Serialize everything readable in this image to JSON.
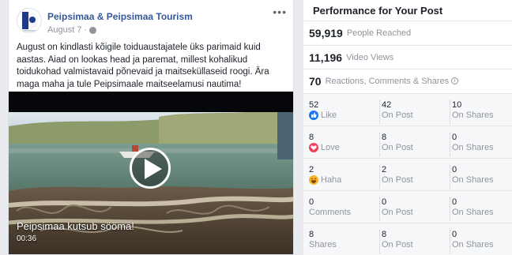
{
  "post": {
    "page_name": "Peipsimaa & Peipsimaa Tourism",
    "date": "August 7",
    "dot": "·",
    "more": "•••",
    "text": "August on kindlasti kõigile toiduaustajatele üks parimaid kuid aastas. Aiad on lookas head ja paremat, millest kohalikud toidukohad valmistavaid põnevaid ja maitseküllaseid roogi. Ära maga maha ja tule Peipsimaale maitseelamusi nautima!",
    "video": {
      "caption": "Peipsimaa kutsub sööma!",
      "time": "00:36"
    }
  },
  "performance": {
    "title": "Performance for Your Post",
    "people_reached": {
      "value": "59,919",
      "label": "People Reached"
    },
    "video_views": {
      "value": "11,196",
      "label": "Video Views"
    },
    "reactions": {
      "value": "70",
      "label": "Reactions, Comments & Shares",
      "info": "i"
    },
    "rows": [
      {
        "total": "52",
        "label": "Like",
        "icon": "like-icon",
        "on_post": "42",
        "on_shares": "10"
      },
      {
        "total": "8",
        "label": "Love",
        "icon": "love-icon",
        "on_post": "8",
        "on_shares": "0"
      },
      {
        "total": "2",
        "label": "Haha",
        "icon": "haha-icon",
        "on_post": "2",
        "on_shares": "0"
      },
      {
        "total": "0",
        "label": "Comments",
        "icon": "",
        "on_post": "0",
        "on_shares": "0"
      },
      {
        "total": "8",
        "label": "Shares",
        "icon": "",
        "on_post": "8",
        "on_shares": "0"
      }
    ],
    "on_post_label": "On Post",
    "on_shares_label": "On Shares"
  },
  "colors": {
    "link": "#365899",
    "like": "#1877f2",
    "love": "#f33e58",
    "haha": "#f7b125",
    "muted": "#90949c"
  }
}
